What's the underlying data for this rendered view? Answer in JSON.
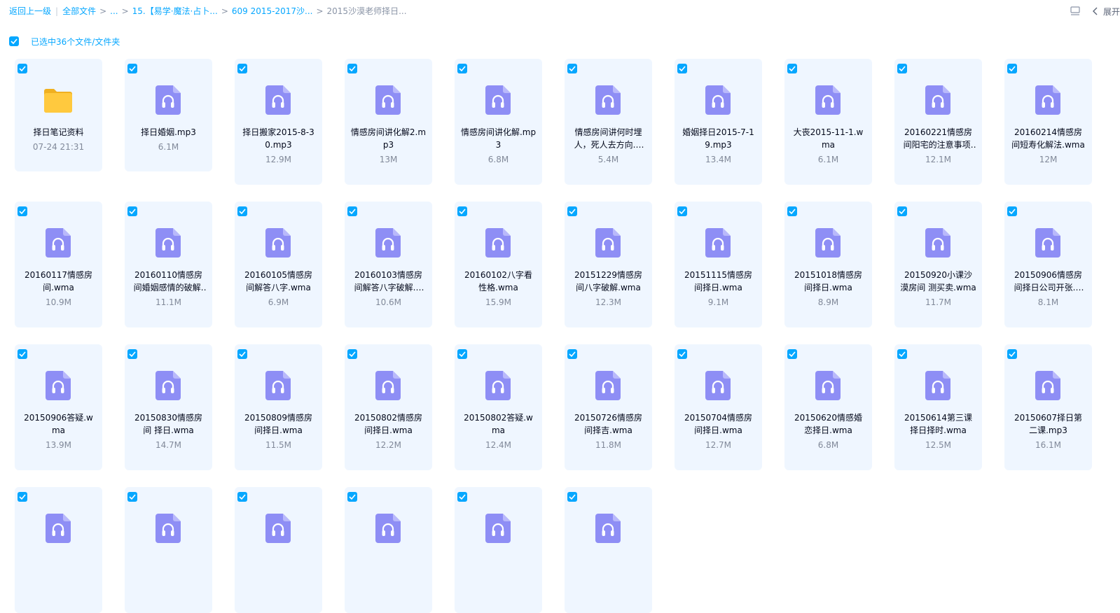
{
  "breadcrumb": {
    "back": "返回上一级",
    "all_files": "全部文件",
    "ellipsis": "...",
    "level1": "15.【易学·魔法·占卜...",
    "level2": "609 2015-2017沙...",
    "current": "2015沙漠老师择日..."
  },
  "toolbar": {
    "expand_label": "展开"
  },
  "selection": {
    "text": "已选中36个文件/文件夹"
  },
  "colors": {
    "accent": "#06a7ff",
    "card_bg": "#eff6ff",
    "audio_icon": "#8e8ef5",
    "folder": "#ffc93e"
  },
  "files": [
    {
      "name": "择日笔记资料",
      "meta": "07-24 21:31",
      "icon": "folder-icon"
    },
    {
      "name": "择日婚姻.mp3",
      "meta": "6.1M",
      "icon": "audio-file-icon"
    },
    {
      "name": "择日搬家2015-8-30.mp3",
      "meta": "12.9M",
      "icon": "audio-file-icon"
    },
    {
      "name": "情感房间讲化解2.mp3",
      "meta": "13M",
      "icon": "audio-file-icon"
    },
    {
      "name": "情感房间讲化解.mp3",
      "meta": "6.8M",
      "icon": "audio-file-icon"
    },
    {
      "name": "情感房间讲何时埋人，死人去方向.wma",
      "meta": "5.4M",
      "icon": "audio-file-icon"
    },
    {
      "name": "婚姻择日2015-7-19.mp3",
      "meta": "13.4M",
      "icon": "audio-file-icon"
    },
    {
      "name": "大丧2015-11-1.wma",
      "meta": "6.1M",
      "icon": "audio-file-icon"
    },
    {
      "name": "20160221情感房间阳宅的注意事项.wma",
      "meta": "12.1M",
      "icon": "audio-file-icon"
    },
    {
      "name": "20160214情感房间短寿化解法.wma",
      "meta": "12M",
      "icon": "audio-file-icon"
    },
    {
      "name": "20160117情感房间.wma",
      "meta": "10.9M",
      "icon": "audio-file-icon"
    },
    {
      "name": "20160110情感房间婚姻感情的破解.wma",
      "meta": "11.1M",
      "icon": "audio-file-icon"
    },
    {
      "name": "20160105情感房间解答八字.wma",
      "meta": "6.9M",
      "icon": "audio-file-icon"
    },
    {
      "name": "20160103情感房间解答八字破解.wma",
      "meta": "10.6M",
      "icon": "audio-file-icon"
    },
    {
      "name": "20160102八字看性格.wma",
      "meta": "15.9M",
      "icon": "audio-file-icon"
    },
    {
      "name": "20151229情感房间八字破解.wma",
      "meta": "12.3M",
      "icon": "audio-file-icon"
    },
    {
      "name": "20151115情感房间择日.wma",
      "meta": "9.1M",
      "icon": "audio-file-icon"
    },
    {
      "name": "20151018情感房间择日.wma",
      "meta": "8.9M",
      "icon": "audio-file-icon"
    },
    {
      "name": "20150920小课沙漠房间 测买卖.wma",
      "meta": "11.7M",
      "icon": "audio-file-icon"
    },
    {
      "name": "20150906情感房间择日公司开张.wma",
      "meta": "8.1M",
      "icon": "audio-file-icon"
    },
    {
      "name": "20150906答疑.wma",
      "meta": "13.9M",
      "icon": "audio-file-icon"
    },
    {
      "name": "20150830情感房间 择日.wma",
      "meta": "14.7M",
      "icon": "audio-file-icon"
    },
    {
      "name": "20150809情感房间择日.wma",
      "meta": "11.5M",
      "icon": "audio-file-icon"
    },
    {
      "name": "20150802情感房间择日.wma",
      "meta": "12.2M",
      "icon": "audio-file-icon"
    },
    {
      "name": "20150802答疑.wma",
      "meta": "12.4M",
      "icon": "audio-file-icon"
    },
    {
      "name": "20150726情感房间择吉.wma",
      "meta": "11.8M",
      "icon": "audio-file-icon"
    },
    {
      "name": "20150704情感房间择日.wma",
      "meta": "12.7M",
      "icon": "audio-file-icon"
    },
    {
      "name": "20150620情感婚恋择日.wma",
      "meta": "6.8M",
      "icon": "audio-file-icon"
    },
    {
      "name": "20150614第三课择日择时.wma",
      "meta": "12.5M",
      "icon": "audio-file-icon"
    },
    {
      "name": "20150607择日第二课.mp3",
      "meta": "16.1M",
      "icon": "audio-file-icon"
    },
    {
      "name": "",
      "meta": "",
      "icon": "audio-file-icon"
    },
    {
      "name": "",
      "meta": "",
      "icon": "audio-file-icon"
    },
    {
      "name": "",
      "meta": "",
      "icon": "audio-file-icon"
    },
    {
      "name": "",
      "meta": "",
      "icon": "audio-file-icon"
    },
    {
      "name": "",
      "meta": "",
      "icon": "audio-file-icon"
    },
    {
      "name": "",
      "meta": "",
      "icon": "audio-file-icon"
    }
  ]
}
